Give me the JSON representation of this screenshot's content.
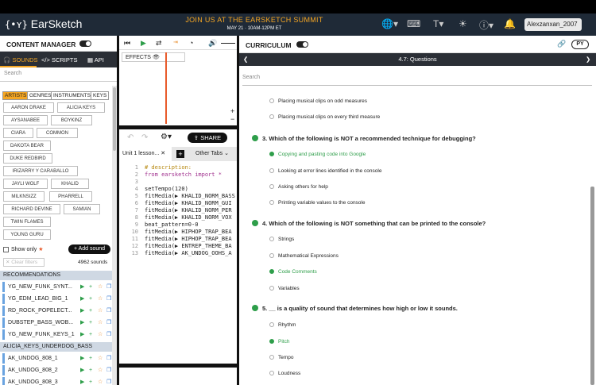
{
  "header": {
    "app_name": "EarSketch",
    "banner_title": "JOIN US AT THE EARSKETCH SUMMIT",
    "banner_sub": "MAY 21 · 10AM-12PM ET",
    "username": "Alexzanxan_2007"
  },
  "content_manager": {
    "title": "CONTENT MANAGER",
    "tabs": [
      "SOUNDS",
      "SCRIPTS",
      "API"
    ],
    "search_placeholder": "Search",
    "filter_tabs": [
      "ARTISTS",
      "GENRES",
      "INSTRUMENTS",
      "KEYS"
    ],
    "artists": [
      "AARON DRAKE",
      "ALICIA KEYS",
      "AYSANABEE",
      "BOYKINZ",
      "CIARA",
      "COMMON",
      "DAKOTA BEAR",
      "DUKE REDBIRD",
      "IRIZARRY Y CARABALLO",
      "JAYLI WOLF",
      "KHALID",
      "MILKNSIZZ",
      "PHARRELL",
      "RICHARD DEVINE",
      "SAMIAN",
      "TWIN FLAMES",
      "YOUNG GURU"
    ],
    "show_only": "Show only",
    "add_sound": "+ Add sound",
    "clear_filters": "✕ Clear filters",
    "sound_count": "4962 sounds",
    "recommendations_header": "RECOMMENDATIONS",
    "recommendations": [
      "YG_NEW_FUNK_SYNT...",
      "YG_EDM_LEAD_BIG_1",
      "RD_ROCK_POPELECT...",
      "DUBSTEP_BASS_WOB...",
      "YG_NEW_FUNK_KEYS_1"
    ],
    "folder_header": "ALICIA_KEYS_UNDERDOG_BASS",
    "folder_sounds": [
      "AK_UNDOG_808_1",
      "AK_UNDOG_808_2",
      "AK_UNDOG_808_3"
    ]
  },
  "daw": {
    "effects_label": "EFFECTS"
  },
  "editor": {
    "share_label": "SHARE",
    "active_tab": "Unit 1 lesson...",
    "other_tabs": "Other Tabs",
    "lines": [
      {
        "n": "1",
        "t": "# description:"
      },
      {
        "n": "2",
        "t": "from earsketch import *"
      },
      {
        "n": "3",
        "t": ""
      },
      {
        "n": "4",
        "t": "setTempo(120)"
      },
      {
        "n": "5",
        "t": "fitMedia(▶ KHALID_NORM_BASS"
      },
      {
        "n": "6",
        "t": "fitMedia(▶ KHALID_NORM_GUI"
      },
      {
        "n": "7",
        "t": "fitMedia(▶ KHALID_NORM_PER"
      },
      {
        "n": "8",
        "t": "fitMedia(▶ KHALID_NORM_VOX"
      },
      {
        "n": "9",
        "t": "beat_pattern=0-0"
      },
      {
        "n": "10",
        "t": "fitMedia(▶ HIPHOP_TRAP_BEA"
      },
      {
        "n": "11",
        "t": "fitMedia(▶ HIPHOP_TRAP_BEA"
      },
      {
        "n": "12",
        "t": "fitMedia(▶ ENTREP_THEME_BA"
      },
      {
        "n": "13",
        "t": "fitMedia(▶ AK_UNDOG_OOHS_A"
      }
    ]
  },
  "curriculum": {
    "title": "CURRICULUM",
    "lang_badge": "PY",
    "chapter": "4.7: Questions",
    "search_placeholder": "Search",
    "prev_options": [
      "Placing musical clips on odd measures",
      "Placing musical clips on every third measure"
    ],
    "questions": [
      {
        "text": "3. Which of the following is NOT a recommended technique for debugging?",
        "options": [
          {
            "label": "Copying and pasting code into Google",
            "correct": true
          },
          {
            "label": "Looking at error lines identified in the console",
            "correct": false
          },
          {
            "label": "Asking others for help",
            "correct": false
          },
          {
            "label": "Printing variable values to the console",
            "correct": false
          }
        ]
      },
      {
        "text": "4. Which of the following is NOT something that can be printed to the console?",
        "options": [
          {
            "label": "Strings",
            "correct": false
          },
          {
            "label": "Mathematical Expressions",
            "correct": false
          },
          {
            "label": "Code Comments",
            "correct": true
          },
          {
            "label": "Variables",
            "correct": false
          }
        ]
      },
      {
        "text": "5. __ is a quality of sound that determines how high or low it sounds.",
        "options": [
          {
            "label": "Rhythm",
            "correct": false
          },
          {
            "label": "Pitch",
            "correct": true
          },
          {
            "label": "Tempo",
            "correct": false
          },
          {
            "label": "Loudness",
            "correct": false
          }
        ]
      }
    ]
  },
  "colors": {
    "accent": "#f5a623",
    "header_bg": "#1f2a37",
    "correct_green": "#2e9e4a"
  }
}
